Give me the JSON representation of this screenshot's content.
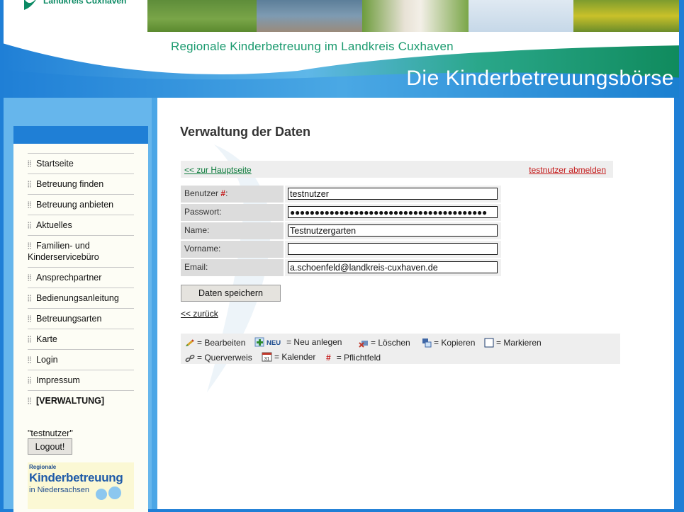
{
  "colors": {
    "frame_blue": "#1f7fd6",
    "sidebar_blue": "#66b6ec",
    "brand_green": "#1a9a6e",
    "link_red": "#c41a1a",
    "link_green": "#0b7a3a"
  },
  "header": {
    "logo_text": "Landkreis Cuxhaven",
    "subtitle": "Regionale Kinderbetreuung im Landkreis Cuxhaven",
    "banner_title": "Die Kinderbetreuungsbörse"
  },
  "sidebar": {
    "items": [
      {
        "label": "Startseite"
      },
      {
        "label": "Betreuung finden"
      },
      {
        "label": "Betreuung anbieten"
      },
      {
        "label": "Aktuelles"
      },
      {
        "label": "Familien- und Kinderservicebüro"
      },
      {
        "label": "Ansprechpartner"
      },
      {
        "label": "Bedienungsanleitung"
      },
      {
        "label": "Betreuungsarten"
      },
      {
        "label": "Karte"
      },
      {
        "label": "Login"
      },
      {
        "label": "Impressum"
      },
      {
        "label": "[VERWALTUNG]"
      }
    ],
    "current_user": "\"testnutzer\"",
    "logout_label": "Logout!",
    "badge": {
      "line1": "Regionale",
      "line2": "Kinderbetreuung",
      "line3": "in Niedersachsen"
    }
  },
  "main": {
    "title": "Verwaltung der Daten",
    "back_to_home": "<< zur Hauptseite",
    "logout_link": "testnutzer abmelden",
    "form": {
      "fields": [
        {
          "label": "Benutzer",
          "required_mark": "#",
          "suffix": ":",
          "value": "testnutzer"
        },
        {
          "label": "Passwort:",
          "value": "●●●●●●●●●●●●●●●●●●●●●●●●●●●●●●●●●●●●●●●●"
        },
        {
          "label": "Name:",
          "value": "Testnutzergarten"
        },
        {
          "label": "Vorname:",
          "value": ""
        },
        {
          "label": "Email:",
          "value": "a.schoenfeld@landkreis-cuxhaven.de"
        }
      ],
      "save_label": "Daten speichern"
    },
    "back_label": "<< zurück",
    "legend": {
      "edit": "= Bearbeiten",
      "new_tag": "NEU",
      "new": "= Neu anlegen",
      "delete": "= Löschen",
      "copy": "= Kopieren",
      "mark": "= Markieren",
      "crossref": "= Querverweis",
      "calendar": "= Kalender",
      "required_mark": "#",
      "required": "= Pflichtfeld"
    }
  }
}
